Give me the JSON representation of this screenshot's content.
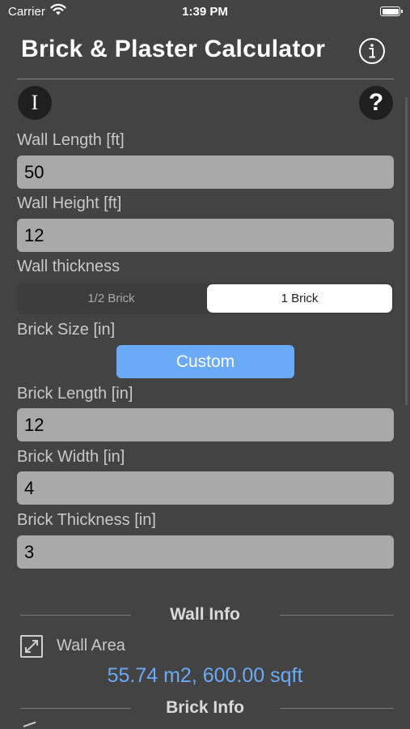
{
  "status_bar": {
    "carrier": "Carrier",
    "time": "1:39 PM"
  },
  "nav": {
    "title": "Brick & Plaster Calculator",
    "info_icon": "info-circle-icon"
  },
  "buttons": {
    "imperial": "I",
    "help": "?"
  },
  "wall_length": {
    "label": "Wall Length [ft]",
    "value": "50"
  },
  "wall_height": {
    "label": "Wall Height [ft]",
    "value": "12"
  },
  "wall_thickness": {
    "label": "Wall thickness",
    "options": [
      "1/2 Brick",
      "1 Brick"
    ],
    "selected": "1 Brick"
  },
  "brick_size": {
    "label": "Brick Size [in]",
    "button": "Custom"
  },
  "brick_length": {
    "label": "Brick Length [in]",
    "value": "12"
  },
  "brick_width": {
    "label": "Brick Width [in]",
    "value": "4"
  },
  "brick_thickness": {
    "label": "Brick Thickness [in]",
    "value": "3"
  },
  "wall_info": {
    "title": "Wall Info",
    "area_label": "Wall Area",
    "area_value": "55.74 m2, 600.00 sqft"
  },
  "brick_info": {
    "title": "Brick Info"
  },
  "colors": {
    "background": "#434343",
    "accent": "#6aaaf6",
    "input_bg": "#a9a9a9"
  }
}
